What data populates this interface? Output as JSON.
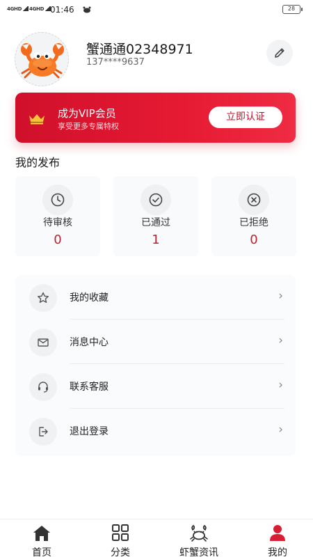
{
  "status_bar": {
    "signal1": "4GHD",
    "signal2": "4GHD",
    "time": "01:46",
    "battery": "28"
  },
  "profile": {
    "name": "蟹通通02348971",
    "phone": "137****9637"
  },
  "vip": {
    "title": "成为VIP会员",
    "subtitle": "享受更多专属特权",
    "button": "立即认证"
  },
  "posts": {
    "title": "我的发布",
    "stats": [
      {
        "label": "待审核",
        "count": "0",
        "icon": "clock-icon"
      },
      {
        "label": "已通过",
        "count": "1",
        "icon": "check-circle-icon"
      },
      {
        "label": "已拒绝",
        "count": "0",
        "icon": "x-circle-icon"
      }
    ]
  },
  "menu": [
    {
      "label": "我的收藏",
      "icon": "star-icon"
    },
    {
      "label": "消息中心",
      "icon": "mail-icon"
    },
    {
      "label": "联系客服",
      "icon": "headset-icon"
    },
    {
      "label": "退出登录",
      "icon": "logout-icon"
    }
  ],
  "nav": [
    {
      "label": "首页",
      "icon": "home-icon"
    },
    {
      "label": "分类",
      "icon": "grid-icon"
    },
    {
      "label": "虾蟹资讯",
      "icon": "crab-icon"
    },
    {
      "label": "我的",
      "icon": "user-icon",
      "active": true
    }
  ],
  "colors": {
    "accent": "#d81e34",
    "count": "#b8232f",
    "active_nav": "#d81e34"
  }
}
